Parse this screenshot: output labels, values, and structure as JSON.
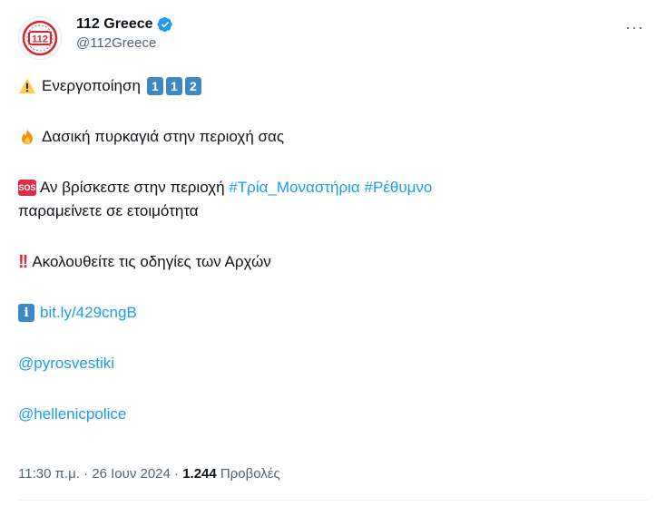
{
  "account": {
    "display_name": "112 Greece",
    "handle": "@112Greece",
    "avatar_text": "112",
    "more_label": "···"
  },
  "tweet": {
    "line1_text": "Ενεργοποίηση",
    "line1_keys": [
      "1",
      "1",
      "2"
    ],
    "line2_text": "Δασική πυρκαγιά στην περιοχή σας",
    "line3_sos": "SOS",
    "line3_text": "Αν βρίσκεστε στην περιοχή ",
    "line3_tag1": "#Τρία_Μοναστήρια",
    "line3_tag2": "#Ρέθυμνο",
    "line4_text": "παραμείνετε σε ετοιμότητα",
    "line5_bang": "!!",
    "line5_text": "Ακολουθείτε τις οδηγίες των Αρχών",
    "line6_info": "i",
    "line6_link": "bit.ly/429cngB",
    "mention1": "@pyrosvestiki",
    "mention2": "@hellenicpolice"
  },
  "meta": {
    "time_date": "11:30 π.μ. · 26 Ιουν 2024 · ",
    "views_count": "1.244",
    "views_label": " Προβολές"
  },
  "colors": {
    "link": "#1d9bf0",
    "verified": "#1d9bf0",
    "brand_red": "#d9262c"
  }
}
